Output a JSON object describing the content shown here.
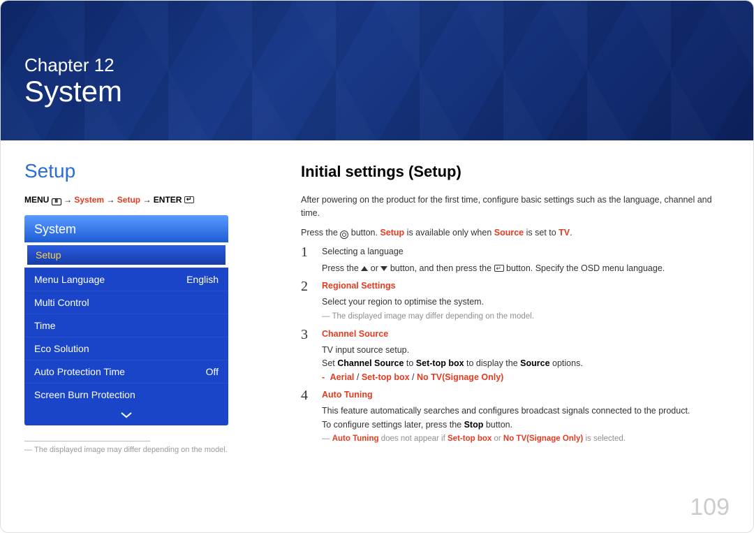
{
  "banner": {
    "chapter": "Chapter 12",
    "title": "System"
  },
  "left": {
    "title": "Setup",
    "breadcrumb": {
      "menu": "MENU",
      "arrow": "→",
      "system": "System",
      "setup": "Setup",
      "enter": "ENTER"
    },
    "menu": {
      "header": "System",
      "items": [
        {
          "label": "Setup",
          "value": "",
          "selected": true
        },
        {
          "label": "Menu Language",
          "value": "English"
        },
        {
          "label": "Multi Control",
          "value": ""
        },
        {
          "label": "Time",
          "value": ""
        },
        {
          "label": "Eco Solution",
          "value": ""
        },
        {
          "label": "Auto Protection Time",
          "value": "Off"
        },
        {
          "label": "Screen Burn Protection",
          "value": ""
        }
      ]
    },
    "footnote": "The displayed image may differ depending on the model."
  },
  "right": {
    "heading": "Initial settings (Setup)",
    "intro": "After powering on the product for the first time, configure basic settings such as the language, channel and time.",
    "press_pre": "Press the ",
    "press_mid": " button. ",
    "setup_word": "Setup",
    "press_mid2": " is available only when ",
    "source_word": "Source",
    "press_end": " is set to ",
    "tv_word": "TV",
    "step1": {
      "lead": "Selecting a language",
      "body_pre": "Press the ",
      "body_mid": " or ",
      "body_mid2": " button, and then press the ",
      "body_end": " button. Specify the OSD menu language."
    },
    "step2": {
      "title": "Regional Settings",
      "body": "Select your region to optimise the system.",
      "note": "The displayed image may differ depending on the model."
    },
    "step3": {
      "title": "Channel Source",
      "body": "TV input source setup.",
      "set_pre": "Set ",
      "cs": "Channel Source",
      "set_mid": " to ",
      "stb": "Set-top box",
      "set_mid2": " to display the ",
      "src": "Source",
      "set_end": " options.",
      "opts": {
        "aerial": "Aerial",
        "stb": "Set-top box",
        "notv": "No TV(Signage Only)"
      }
    },
    "step4": {
      "title": "Auto Tuning",
      "body1": "This feature automatically searches and configures broadcast signals connected to the product.",
      "body2_pre": "To configure settings later, press the ",
      "stop": "Stop",
      "body2_end": " button.",
      "note_pre": "Auto Tuning",
      "note_mid": " does not appear if ",
      "note_stb": "Set-top box",
      "note_or": " or ",
      "note_notv": "No TV(Signage Only)",
      "note_end": " is selected."
    }
  },
  "pageNumber": "109"
}
